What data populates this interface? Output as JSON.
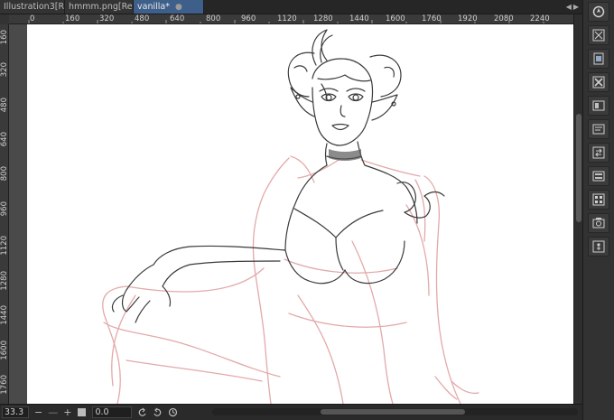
{
  "tabs": [
    {
      "label": "Illustration3[Re",
      "active": false
    },
    {
      "label": "hmmm.png[Re",
      "active": false
    },
    {
      "label": "vanilla*",
      "active": true
    }
  ],
  "tab_close_glyph": "●",
  "tab_scroll": {
    "left": "◀",
    "right": "▶"
  },
  "ruler_h": [
    "0",
    "160",
    "320",
    "480",
    "640",
    "800",
    "960",
    "1120",
    "1280",
    "1440",
    "1600",
    "1760",
    "1920",
    "2080",
    "2240"
  ],
  "ruler_v": [
    "160",
    "320",
    "480",
    "640",
    "800",
    "960",
    "1120",
    "1280",
    "1440",
    "1600",
    "1760"
  ],
  "statusbar": {
    "zoom": "33.3",
    "zoom_out": "−",
    "zoom_in": "+",
    "rotation": "0.0"
  },
  "docker_icons": [
    "navigator-icon",
    "layer-properties-icon",
    "layer-duplicate-icon",
    "layer-clear-icon",
    "layer-mask-icon",
    "layer-copy-icon",
    "layer-transfer-icon",
    "layer-merge-icon",
    "layer-fill-icon",
    "layer-export-icon",
    "layer-lock-icon"
  ],
  "colors": {
    "accent_tab": "#3e5f8a",
    "sketch_line": "#3a3a3a",
    "underdrawing": "#e3a9a9"
  }
}
